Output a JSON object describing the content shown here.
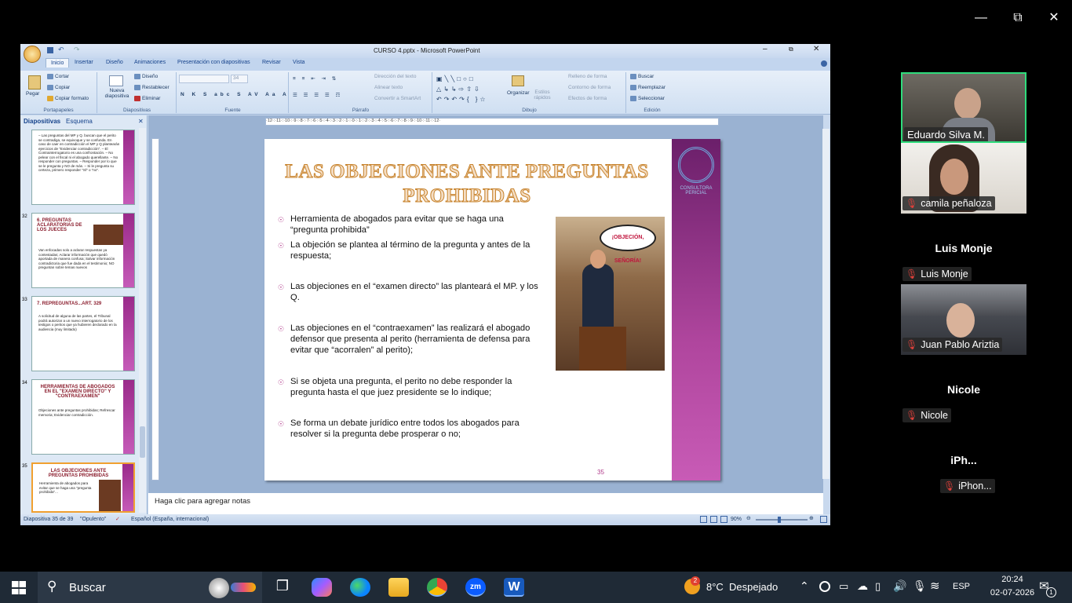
{
  "ppt": {
    "title": "CURSO 4.pptx - Microsoft PowerPoint",
    "tabs": [
      "Inicio",
      "Insertar",
      "Diseño",
      "Animaciones",
      "Presentación con diapositivas",
      "Revisar",
      "Vista"
    ],
    "clipboard": {
      "paste": "Pegar",
      "cut": "Cortar",
      "copy": "Copiar",
      "format": "Copiar formato",
      "label": "Portapapeles"
    },
    "slides_group": {
      "new": "Nueva diapositiva",
      "design": "Diseño",
      "reset": "Restablecer",
      "delete": "Eliminar",
      "label": "Diapositivas"
    },
    "font_group": {
      "size": "34",
      "label": "Fuente"
    },
    "paragraph_group": {
      "dir": "Dirección del texto",
      "align": "Alinear texto",
      "smartart": "Convertir a SmartArt",
      "label": "Párrafo"
    },
    "drawing_group": {
      "arrange": "Organizar",
      "styles": "Estilos rápidos",
      "fill": "Relleno de forma",
      "outline": "Contorno de forma",
      "effects": "Efectos de forma",
      "label": "Dibujo"
    },
    "edit_group": {
      "find": "Buscar",
      "replace": "Reemplazar",
      "select": "Seleccionar",
      "label": "Edición"
    },
    "pane_tabs": [
      "Diapositivas",
      "Esquema"
    ],
    "ruler_text": "·12·:·11·:·10·:·9·:·8·:·7·:·6·:·5·:·4·:·3·:·2·:·1·:·0·:·1·:·2·:·3·:·4·:·5·:·6·:·7·:·8·:·9·:·10·:·11·:·12·",
    "thumbs": [
      {
        "num": "31",
        "title": "",
        "text": "– Las preguntas del MP y Q. buscan que el perito se contradiga, se equivoque y se confunda. En caso de caer en contradicción el MP y Q plantearán ejercicios de \"Evidenciar contradicción\". – El Contrainterrogatorio es una confrontación. – No pelear con el fiscal ni el abogado querellante. – No responder con preguntas. – Responder por lo que se le pregunta y NO de más. – Si le pregunta su certeza, primero responder \"SÍ\" o \"no\"."
      },
      {
        "num": "32",
        "title": "6. PREGUNTAS ACLARATORIAS DE LOS JUECES",
        "text": "Van enfocadas solo a aclarar respuestas ya contestadas; Aclarar información que quedó aportada de manera confusa; Salvar información contradictoria que fue dada en el testimonio; NO preguntan sobre temas nuevos"
      },
      {
        "num": "33",
        "title": "7. REPREGUNTAS...ART. 329",
        "text": "A solicitud de alguna de las partes, el Tribunal podrá autorizar a un nuevo interrogatorio de los testigos o peritos que ya hubieren declarado en la audiencia (muy limitado)"
      },
      {
        "num": "34",
        "title": "HERRAMIENTAS DE ABOGADOS EN EL \"EXAMEN DIRECTO\" Y \"CONTRAEXAMEN\"",
        "text": "Objeciones ante preguntas prohibidas; Refrescar memoria; Evidenciar contradicción."
      },
      {
        "num": "35",
        "title": "LAS OBJECIONES ANTE PREGUNTAS PROHIBIDAS",
        "text": "Herramienta de abogados para evitar que se haga una \"pregunta prohibida\"..."
      }
    ],
    "slide": {
      "title": "LAS OBJECIONES ANTE PREGUNTAS PROHIBIDAS",
      "bullets": [
        "Herramienta de abogados para evitar que se haga una “pregunta prohibida”",
        "La objeción se plantea al término de la pregunta y antes de la respuesta;",
        "Las objeciones en el “examen directo” las planteará el MP. y los Q.",
        "Las objeciones en el “contraexamen” las realizará el abogado defensor que presenta al perito (herramienta de defensa para evitar que “acorralen” al perito);",
        "Si se objeta una pregunta, el perito no debe responder la pregunta hasta el que juez presidente se lo indique;",
        "Se forma un debate jurídico entre todos los abogados para resolver si la pregunta debe prosperar o no;"
      ],
      "image_bubble": "¡OBJECIÓN, SEÑORÍA!",
      "logo_text": "CONSULTORA PERICIAL",
      "number": "35"
    },
    "notes_placeholder": "Haga clic para agregar notas",
    "status": {
      "slide": "Diapositiva 35 de 39",
      "theme": "\"Opulento\"",
      "lang": "Español (España, internacional)",
      "zoom": "90%"
    }
  },
  "participants": [
    {
      "name": "Eduardo Silva M.",
      "video": true
    },
    {
      "name": "camila peñaloza",
      "video": true
    },
    {
      "name": "Luis Monje",
      "video": false
    },
    {
      "name": "Juan Pablo Ariztia",
      "video": true
    },
    {
      "name": "Nicole",
      "video": false
    },
    {
      "name": "iPhon...",
      "big": "iPh...",
      "video": false
    }
  ],
  "taskbar": {
    "search": "Buscar",
    "weather": "8°C  Despejado",
    "weather_badge": "2",
    "lang": "ESP",
    "time": "20:24",
    "date": "02-07-2026",
    "notif": "1"
  }
}
